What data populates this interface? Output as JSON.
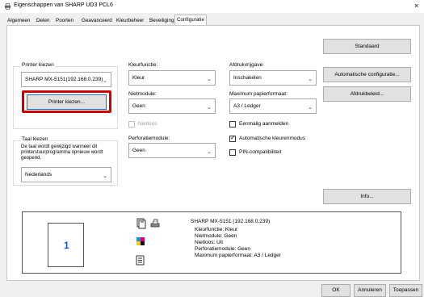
{
  "window": {
    "title": "Eigenschappen van SHARP UD3 PCL6",
    "close_glyph": "×"
  },
  "tabs": [
    "Algemeen",
    "Delen",
    "Poorten",
    "Geavanceerd",
    "Kleurbeheer",
    "Beveiliging",
    "Configuratie"
  ],
  "active_tab": "Configuratie",
  "printer": {
    "label": "Printer kiezen",
    "value": "SHARP MX-5151(192.168.0.239)",
    "button": "Printer kiezen..."
  },
  "language": {
    "label": "Taal kiezen",
    "note": "De taal wordt gewijzigd wanneer dit printerstuurprogramma opnieuw wordt geopend.",
    "value": "Nederlands"
  },
  "colour": {
    "label": "Kleurfunctie:",
    "value": "Kleur"
  },
  "staple": {
    "label": "Nietmodule:",
    "value": "Geen",
    "loose_label": "Nietloos"
  },
  "punch": {
    "label": "Perforatiemodule:",
    "value": "Geen"
  },
  "print_release": {
    "label": "Afdrukvrijgave:",
    "value": "Inschakelen"
  },
  "paper": {
    "label": "Maximum papierformaat:",
    "value": "A3 / Ledger"
  },
  "checks": {
    "single_signon": "Eenmalig aanmelden",
    "auto_colour": "Automatische kleurenmodus",
    "pin": "PIN-compatibiliteit"
  },
  "side_buttons": {
    "standard": "Standaard",
    "auto_config": "Automatische configuratie...",
    "policy": "Afdrukbeleid...",
    "info": "Info..."
  },
  "summary": {
    "title": "SHARP MX-5151 (192.168.0.239)",
    "lines": [
      "Kleurfunctie: Kleur",
      "Nietmodule: Geen",
      "Nietloos: Uit",
      "Perforatiemodule: Geen",
      "Maximum papierformaat: A3 / Ledger"
    ],
    "page_number": "1"
  },
  "footer": {
    "ok": "OK",
    "cancel": "Annuleren",
    "apply": "Toepassen"
  },
  "colors": {
    "highlight": "#d00000",
    "focus": "#0078d7"
  }
}
